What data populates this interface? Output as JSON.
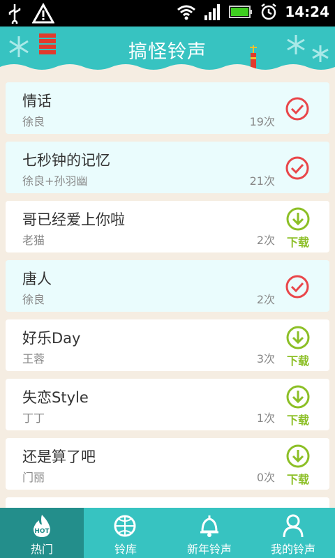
{
  "status_bar": {
    "time": "14:24"
  },
  "header": {
    "title": "搞怪铃声"
  },
  "songs": [
    {
      "name": "情话",
      "artist": "徐良",
      "count": "19次",
      "state": "played"
    },
    {
      "name": "七秒钟的记忆",
      "artist": "徐良+孙羽幽",
      "count": "21次",
      "state": "played"
    },
    {
      "name": "哥已经爱上你啦",
      "artist": "老猫",
      "count": "2次",
      "state": "download",
      "action": "下载"
    },
    {
      "name": "唐人",
      "artist": "徐良",
      "count": "2次",
      "state": "played"
    },
    {
      "name": "好乐Day",
      "artist": "王蓉",
      "count": "3次",
      "state": "download",
      "action": "下载"
    },
    {
      "name": "失恋Style",
      "artist": "丁丁",
      "count": "1次",
      "state": "download",
      "action": "下载"
    },
    {
      "name": "还是算了吧",
      "artist": "门丽",
      "count": "0次",
      "state": "download",
      "action": "下载"
    }
  ],
  "bottom_nav": [
    {
      "label": "热门",
      "icon": "hot-flame-icon",
      "active": true
    },
    {
      "label": "铃库",
      "icon": "globe-note-icon",
      "active": false
    },
    {
      "label": "新年铃声",
      "icon": "bell-icon",
      "active": false
    },
    {
      "label": "我的铃声",
      "icon": "user-icon",
      "active": false
    }
  ],
  "colors": {
    "accent": "#37c3c1",
    "active_tab": "#238e8b",
    "check": "#e9464a",
    "download": "#8cbf26"
  }
}
